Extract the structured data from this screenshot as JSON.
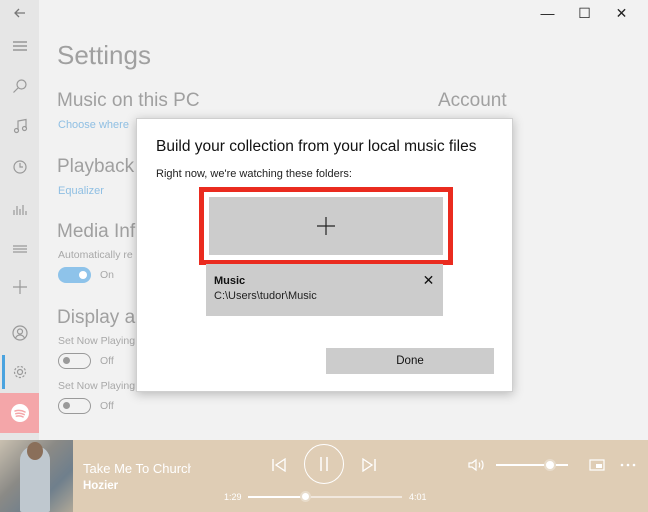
{
  "nav": {
    "items": [
      {
        "name": "back-icon",
        "glyph": "back"
      },
      {
        "name": "hamburger-icon",
        "glyph": "menu"
      },
      {
        "name": "search-icon",
        "glyph": "search"
      },
      {
        "name": "music-note-icon",
        "glyph": "note"
      },
      {
        "name": "recent-icon",
        "glyph": "clock"
      },
      {
        "name": "now-playing-icon",
        "glyph": "bars"
      },
      {
        "name": "queue-icon",
        "glyph": "list"
      },
      {
        "name": "add-icon",
        "glyph": "plus"
      },
      {
        "name": "user-icon",
        "glyph": "user"
      },
      {
        "name": "settings-icon",
        "glyph": "gear"
      },
      {
        "name": "spotify-icon",
        "glyph": "spotify"
      }
    ]
  },
  "settings": {
    "title": "Settings",
    "music_section": "Music on this PC",
    "music_link": "Choose where",
    "account_section": "Account",
    "playback_section": "Playback",
    "equalizer_link": "Equalizer",
    "media_section": "Media Inf",
    "media_auto": "Automatically re",
    "media_toggle": "On",
    "display_section": "Display ar",
    "now_playing_1": "Set Now Playing",
    "toggle_off_1": "Off",
    "now_playing_2": "Set Now Playing",
    "toggle_off_2": "Off"
  },
  "dialog": {
    "title": "Build your collection from your local music files",
    "subtitle": "Right now, we're watching these folders:",
    "add_glyph": "+",
    "folder": {
      "name": "Music",
      "path": "C:\\Users\\tudor\\Music"
    },
    "remove_glyph": "✕",
    "done_label": "Done"
  },
  "player": {
    "track_title": "Take Me To Church",
    "artist": "Hozier",
    "elapsed": "1:29",
    "duration": "4:01",
    "progress": 0.37,
    "volume": 0.75
  },
  "colors": {
    "accent": "#4aa3df",
    "highlight": "#ea2b1f",
    "player_bg": "#dfcdb5",
    "spotify_bg": "#f4a6a9"
  }
}
